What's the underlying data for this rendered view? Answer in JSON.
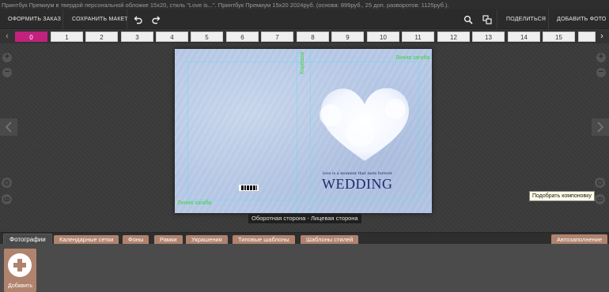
{
  "info_text": "Принтбук Премиум в твердой персональной обложке 15х20, стиль \"Love is...\". Принтбук Премиум 15х20  2024руб. (основа: 899руб., 25 доп. разворотов: 1125руб.).",
  "toolbar": {
    "order_label": "ОФОРМИТЬ ЗАКАЗ",
    "save_label": "СОХРАНИТЬ МАКЕТ",
    "share_label": "ПОДЕЛИТЬСЯ",
    "add_photo_label": "ДОБАВИТЬ ФОТО"
  },
  "pages": [
    "0",
    "1",
    "2",
    "3",
    "4",
    "5",
    "6",
    "7",
    "8",
    "9",
    "10",
    "11",
    "12",
    "13",
    "14",
    "15"
  ],
  "active_page": "0",
  "spread": {
    "fold_line_label": "Линия загиба",
    "spine_label": "Корешок",
    "tagline": "love is a moment that lasts forever",
    "title": "WEDDING",
    "caption": "Оборотная сторона - Лицевая сторона"
  },
  "tooltip": "Подобрать компоновку",
  "bottom_tabs": [
    "Фотографии",
    "Календарные сетки",
    "Фоны",
    "Рамки",
    "Украшения",
    "Типовые шаблоны",
    "Шаблоны стилей"
  ],
  "autofill_label": "Автозаполнение",
  "add_button_label": "Добавить",
  "colors": {
    "accent": "#c2217e",
    "tab_brown": "#b0836f",
    "guide_cyan": "#5ee0f0",
    "fold_green": "#3fd43f",
    "cover_blue": "#b7c9e6"
  }
}
